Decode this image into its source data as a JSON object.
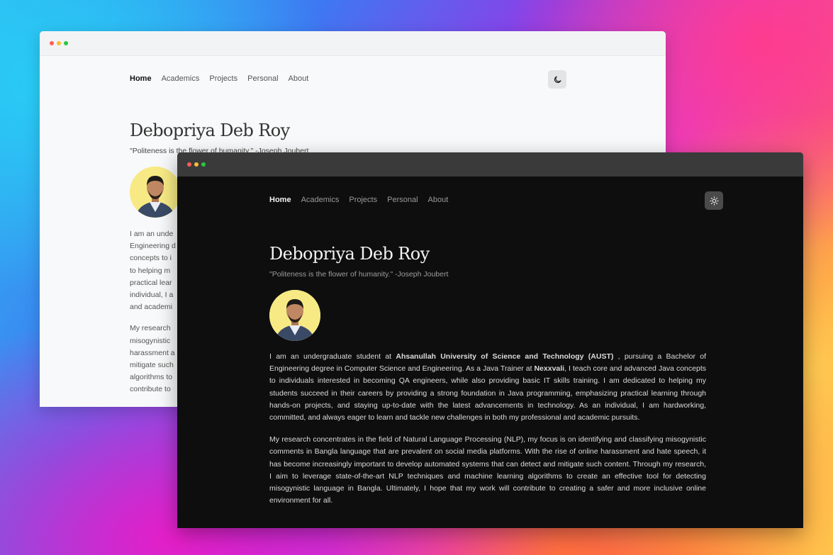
{
  "window_controls": {
    "close_color": "#ff5f57",
    "minimize_color": "#febc2e",
    "maximize_color": "#28c840"
  },
  "nav": {
    "home": "Home",
    "academics": "Academics",
    "projects": "Projects",
    "personal": "Personal",
    "about": "About"
  },
  "theme_toggle": {
    "light_mode_icon": "moon-icon",
    "dark_mode_icon": "sun-icon"
  },
  "profile": {
    "name": "Debopriya Deb Roy",
    "quote": "\"Politeness is the flower of humanity.\" -Joseph Joubert",
    "avatar_icon": "avatar",
    "avatar_bg": "#f7ea85"
  },
  "bio": {
    "p1_a": "I am an undergraduate student at ",
    "p1_b": "Ahsanullah University of Science and Technology (AUST)",
    "p1_c": " , pursuing a Bachelor of Engineering degree in Computer Science and Engineering. As a Java Trainer at ",
    "p1_d": "Nexxvali",
    "p1_e": ", I teach core and advanced Java concepts to individuals interested in becoming QA engineers, while also providing basic IT skills training. I am dedicated to helping my students succeed in their careers by providing a strong foundation in Java programming, emphasizing practical learning through hands-on projects, and staying up-to-date with the latest advancements in technology. As an individual, I am hardworking, committed, and always eager to learn and tackle new challenges in both my professional and academic pursuits.",
    "p2": "My research concentrates in the field of Natural Language Processing (NLP), my focus is on identifying and classifying misogynistic comments in Bangla language that are prevalent on social media platforms. With the rise of online harassment and hate speech, it has become increasingly important to develop automated systems that can detect and mitigate such content. Through my research, I aim to leverage state-of-the-art NLP techniques and machine learning algorithms to create an effective tool for detecting misogynistic language in Bangla. Ultimately, I hope that my work will contribute to creating a safer and more inclusive online environment for all."
  },
  "light_preview": {
    "p1_lines": [
      "I am an unde",
      "Engineering d",
      "concepts to i",
      "to helping m",
      "practical lear",
      "individual, I a",
      "and academi"
    ],
    "p2_lines": [
      "My research",
      "misogynistic",
      "harassment a",
      "mitigate such",
      "algorithms to",
      "contribute to"
    ]
  }
}
